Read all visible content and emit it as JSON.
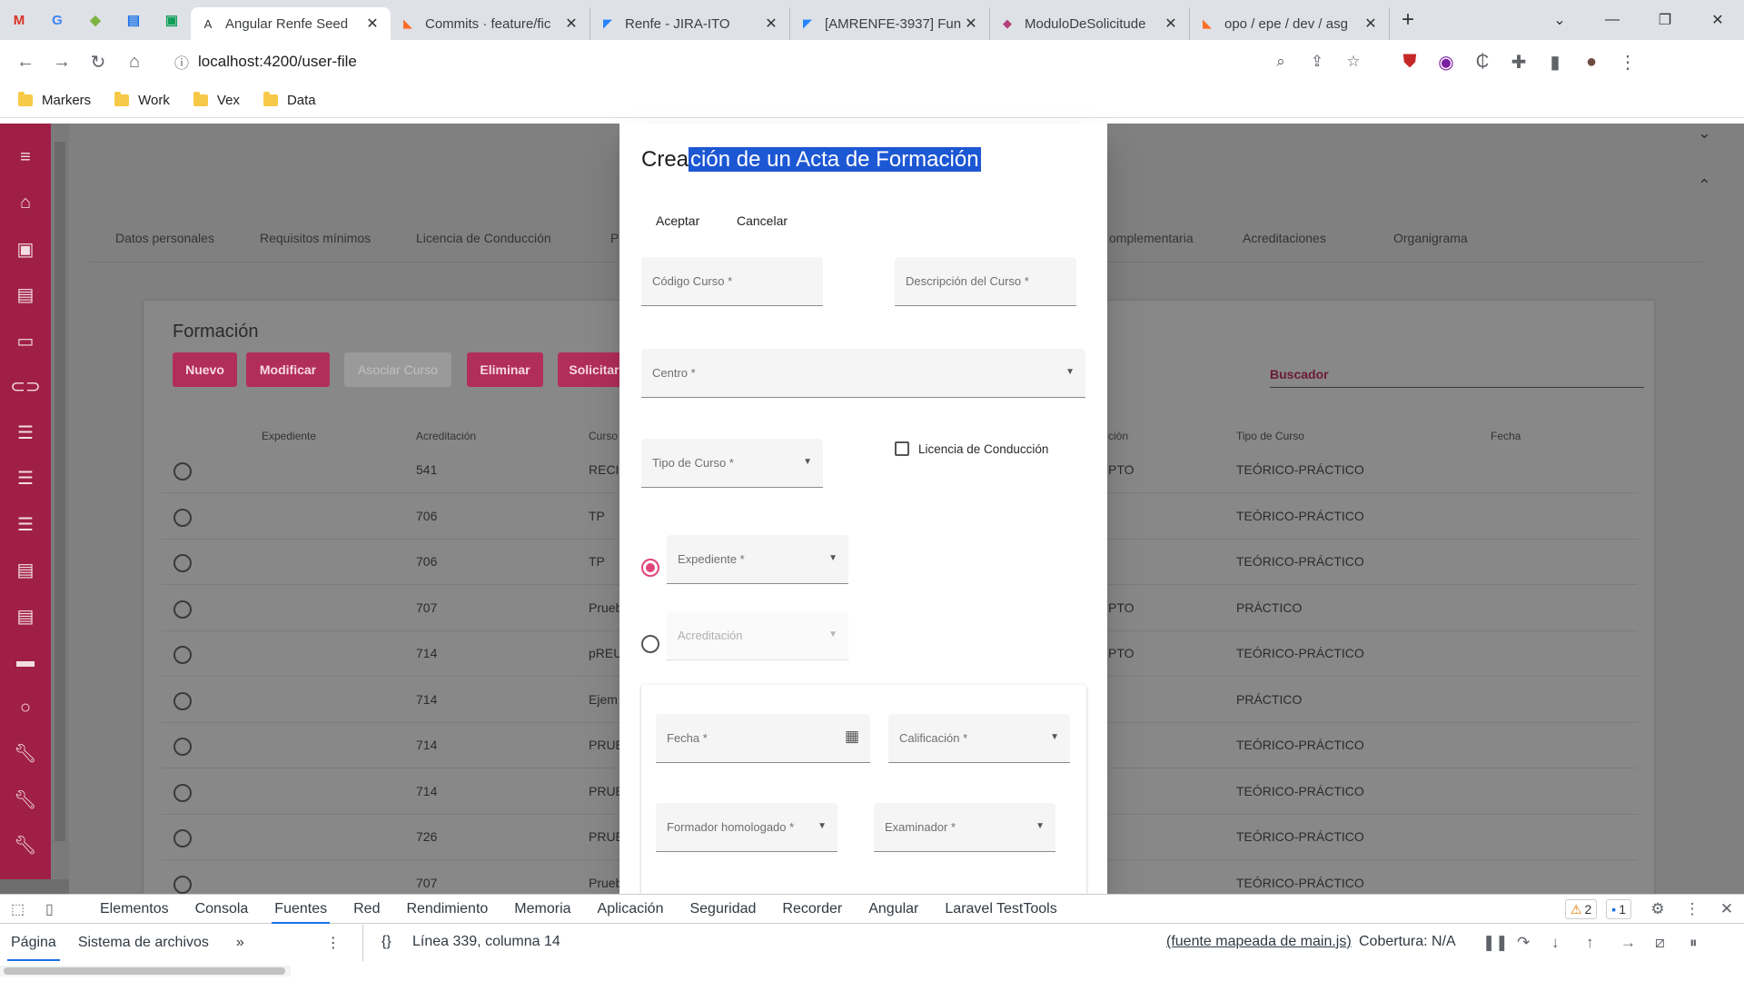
{
  "browser": {
    "pinned": [
      {
        "icon": "gmail-icon",
        "glyph": "M",
        "color": "#d93025"
      },
      {
        "icon": "translate-icon",
        "glyph": "G",
        "color": "#4285f4"
      },
      {
        "icon": "extension-green-icon",
        "glyph": "◆",
        "color": "#7cb342"
      },
      {
        "icon": "docs-icon",
        "glyph": "▤",
        "color": "#1a73e8"
      },
      {
        "icon": "app-green-icon",
        "glyph": "▣",
        "color": "#0f9d58"
      }
    ],
    "tabs": [
      {
        "title": "Angular Renfe Seed",
        "icon": "angular-icon",
        "glyph": "A",
        "color": "#333",
        "active": true
      },
      {
        "title": "Commits · feature/fic",
        "icon": "gitlab-icon",
        "glyph": "◣",
        "color": "#fc6d26",
        "active": false
      },
      {
        "title": "Renfe - JIRA-ITO",
        "icon": "jira-icon",
        "glyph": "◤",
        "color": "#2684ff",
        "active": false
      },
      {
        "title": "[AMRENFE-3937] Fun",
        "icon": "jira-icon",
        "glyph": "◤",
        "color": "#2684ff",
        "active": false
      },
      {
        "title": "ModuloDeSolicitude",
        "icon": "app-purple-icon",
        "glyph": "◆",
        "color": "#b4417a",
        "active": false
      },
      {
        "title": "opo / epe / dev / asg",
        "icon": "gitlab-icon",
        "glyph": "◣",
        "color": "#fc6d26",
        "active": false
      }
    ],
    "url": "localhost:4200/user-file",
    "bookmarks": [
      "Markers",
      "Work",
      "Vex",
      "Data"
    ]
  },
  "app": {
    "section_tabs": [
      "Datos personales",
      "Requisitos mínimos",
      "Licencia de Conducción",
      "P",
      "omplementaria",
      "Acreditaciones",
      "Organigrama"
    ],
    "card_title": "Formación",
    "buttons": {
      "nuevo": "Nuevo",
      "modificar": "Modificar",
      "asociar": "Asociar Curso",
      "eliminar": "Eliminar",
      "solicitar": "Solicitar"
    },
    "buscador": "Buscador",
    "columns": [
      "Expediente",
      "Acreditación",
      "Curso",
      "ción",
      "Tipo de Curso",
      "Fecha"
    ],
    "rows": [
      {
        "acreditacion": "541",
        "curso": "RECI",
        "col4": "PTO",
        "tipo": "TEÓRICO-PRÁCTICO"
      },
      {
        "acreditacion": "706",
        "curso": "TP",
        "col4": "",
        "tipo": "TEÓRICO-PRÁCTICO"
      },
      {
        "acreditacion": "706",
        "curso": "TP",
        "col4": "",
        "tipo": "TEÓRICO-PRÁCTICO"
      },
      {
        "acreditacion": "707",
        "curso": "Prueb",
        "col4": "PTO",
        "tipo": "PRÁCTICO"
      },
      {
        "acreditacion": "714",
        "curso": "pREU",
        "col4": "PTO",
        "tipo": "TEÓRICO-PRÁCTICO"
      },
      {
        "acreditacion": "714",
        "curso": "Ejem",
        "col4": "",
        "tipo": "PRÁCTICO"
      },
      {
        "acreditacion": "714",
        "curso": "PRUE",
        "col4": "",
        "tipo": "TEÓRICO-PRÁCTICO"
      },
      {
        "acreditacion": "714",
        "curso": "PRUE",
        "col4": "",
        "tipo": "TEÓRICO-PRÁCTICO"
      },
      {
        "acreditacion": "726",
        "curso": "PRUE",
        "col4": "",
        "tipo": "TEÓRICO-PRÁCTICO"
      },
      {
        "acreditacion": "707",
        "curso": "Prueb",
        "col4": "",
        "tipo": "TEÓRICO-PRÁCTICO"
      }
    ]
  },
  "dialog": {
    "title_plain": "Crea",
    "title_selected": "ción de un Acta de Formación",
    "accept": "Aceptar",
    "cancel": "Cancelar",
    "fields": {
      "codigo": "Código Curso *",
      "descripcion": "Descripción del Curso *",
      "centro": "Centro *",
      "tipo_curso": "Tipo de Curso *",
      "licencia": "Licencia de Conducción",
      "expediente": "Expediente *",
      "acreditacion": "Acreditación",
      "fecha": "Fecha *",
      "calificacion": "Calificación *",
      "formador": "Formador homologado *",
      "examinador": "Examinador *"
    }
  },
  "devtools": {
    "tabs": [
      "Elementos",
      "Consola",
      "Fuentes",
      "Red",
      "Rendimiento",
      "Memoria",
      "Aplicación",
      "Seguridad",
      "Recorder",
      "Angular",
      "Laravel TestTools"
    ],
    "active_tab": "Fuentes",
    "warnings": "2",
    "messages": "1",
    "source_tabs": [
      "Página",
      "Sistema de archivos"
    ],
    "cursor": "Línea 339, columna 14",
    "mapped": "(fuente mapeada de main.js)",
    "coverage": "Cobertura: N/A"
  },
  "colors": {
    "accent": "#b22e5a",
    "sidebar": "#a01f47",
    "radio_on": "#e0457a",
    "selection": "#1c57d4"
  }
}
